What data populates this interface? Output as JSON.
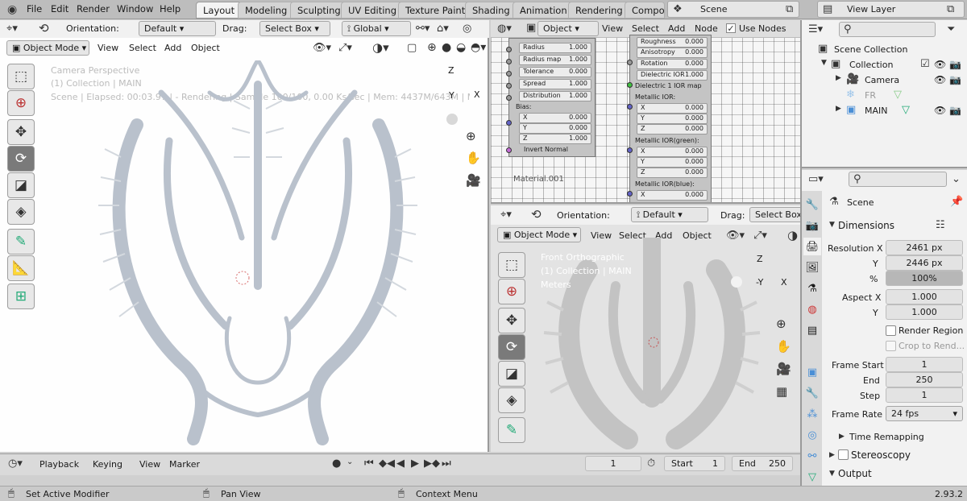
{
  "topbar": {
    "menus": [
      "File",
      "Edit",
      "Render",
      "Window",
      "Help"
    ],
    "workspaces": [
      "Layout",
      "Modeling",
      "Sculpting",
      "UV Editing",
      "Texture Paint",
      "Shading",
      "Animation",
      "Rendering",
      "Compos"
    ],
    "active_workspace": "Layout",
    "scene": "Scene",
    "view_layer": "View Layer"
  },
  "viewport_left": {
    "orientation_label": "Orientation:",
    "orientation": "Default",
    "drag_label": "Drag:",
    "drag": "Select Box",
    "transform_space": "Global",
    "mode": "Object Mode",
    "menus": [
      "View",
      "Select",
      "Add",
      "Object"
    ],
    "overlay_line1": "Camera Perspective",
    "overlay_line2": "(1) Collection | MAIN",
    "overlay_line3": "Scene | Elapsed: 00:03.97 | - Rendering | Sample 100/100, 0.00 Ks/sec | Mem: 4437M/643M | MAIN | Verts:",
    "gizmo": {
      "z": "Z",
      "y": "Y",
      "x": "X"
    }
  },
  "node_editor": {
    "type": "Object",
    "menus": [
      "View",
      "Select",
      "Add",
      "Node"
    ],
    "use_nodes": "Use Nodes",
    "left_fields": [
      {
        "k": "Radius",
        "v": "1.000"
      },
      {
        "k": "Radius map",
        "v": "1.000"
      },
      {
        "k": "Tolerance",
        "v": "0.000"
      },
      {
        "k": "Spread",
        "v": "1.000"
      },
      {
        "k": "Distribution",
        "v": "1.000"
      }
    ],
    "bias_label": "Bias:",
    "bias": [
      {
        "k": "X",
        "v": "0.000"
      },
      {
        "k": "Y",
        "v": "0.000"
      },
      {
        "k": "Z",
        "v": "1.000"
      }
    ],
    "invert_normal": "Invert Normal",
    "material_label": "Material.001",
    "right_top": [
      {
        "k": "Roughness",
        "v": "0.000"
      },
      {
        "k": "Anisotropy",
        "v": "0.000"
      },
      {
        "k": "Rotation",
        "v": "0.000"
      },
      {
        "k": "Dielectric IOR",
        "v": "1.000"
      }
    ],
    "dielectric_map": "Dielectric 1 IOR map",
    "metallic_ior": "Metallic IOR:",
    "metallic_ior_vals": [
      {
        "k": "X",
        "v": "0.000"
      },
      {
        "k": "Y",
        "v": "0.000"
      },
      {
        "k": "Z",
        "v": "0.000"
      }
    ],
    "metallic_green": "Metallic IOR(green):",
    "metallic_green_vals": [
      {
        "k": "X",
        "v": "0.000"
      },
      {
        "k": "Y",
        "v": "0.000"
      },
      {
        "k": "Z",
        "v": "0.000"
      }
    ],
    "metallic_blue": "Metallic IOR(blue):",
    "metallic_blue_vals": [
      {
        "k": "X",
        "v": "0.000"
      }
    ]
  },
  "viewport_right": {
    "orientation_label": "Orientation:",
    "orientation": "Default",
    "drag_label": "Drag:",
    "drag": "Select Box",
    "mode": "Object Mode",
    "menus": [
      "View",
      "Select",
      "Add",
      "Object"
    ],
    "overlay_line1": "Front Orthographic",
    "overlay_line2": "(1) Collection | MAIN",
    "overlay_line3": "Meters",
    "gizmo": {
      "z": "Z",
      "y": "-Y",
      "x": "X"
    }
  },
  "outliner": {
    "items": [
      {
        "label": "Scene Collection"
      },
      {
        "label": "Collection"
      },
      {
        "label": "Camera"
      },
      {
        "label": "FR"
      },
      {
        "label": "MAIN"
      }
    ]
  },
  "properties": {
    "scene": "Scene",
    "dimensions": "Dimensions",
    "res_x_label": "Resolution X",
    "res_x": "2461 px",
    "res_y_label": "Y",
    "res_y": "2446 px",
    "pct_label": "%",
    "pct": "100%",
    "aspect_x_label": "Aspect X",
    "aspect_x": "1.000",
    "aspect_y_label": "Y",
    "aspect_y": "1.000",
    "render_region": "Render Region",
    "crop": "Crop to Rend...",
    "frame_start_label": "Frame Start",
    "frame_start": "1",
    "end_label": "End",
    "end": "250",
    "step_label": "Step",
    "step": "1",
    "frame_rate_label": "Frame Rate",
    "frame_rate": "24 fps",
    "time_remapping": "Time Remapping",
    "stereoscopy": "Stereoscopy",
    "output": "Output"
  },
  "timeline": {
    "menus": [
      "Playback",
      "Keying",
      "View",
      "Marker"
    ],
    "current": "1",
    "start_label": "Start",
    "start": "1",
    "end_label": "End",
    "end": "250"
  },
  "statusbar": {
    "left": "Set Active Modifier",
    "mid": "Pan View",
    "right": "Context Menu",
    "version": "2.93.2"
  }
}
